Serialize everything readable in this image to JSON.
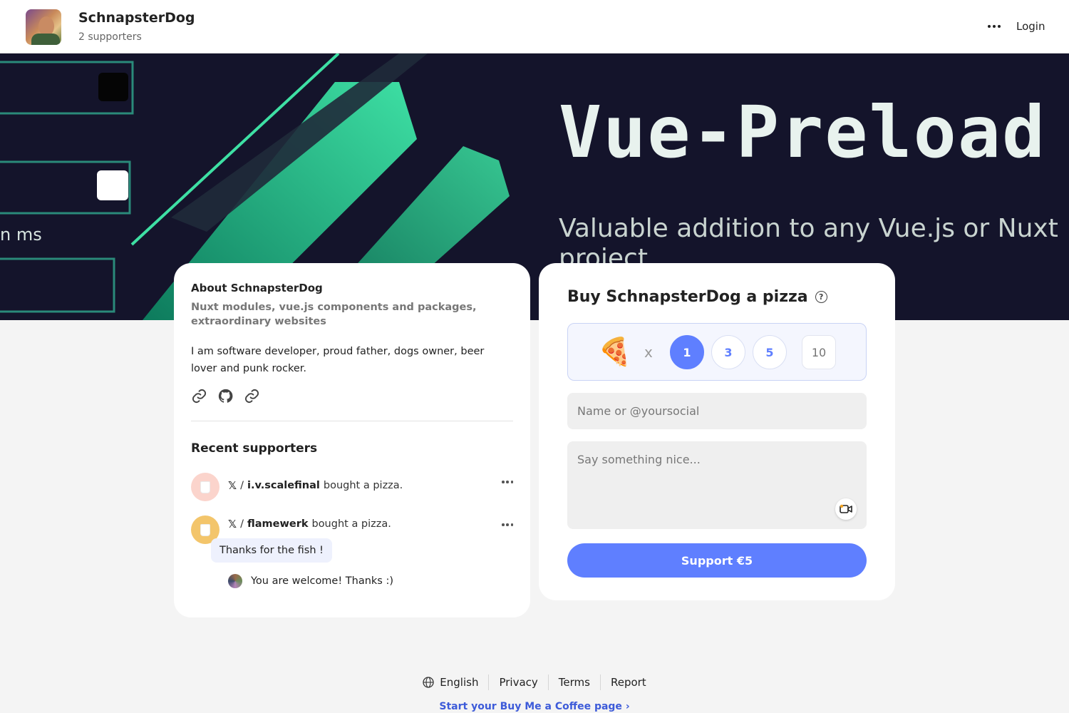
{
  "header": {
    "creator_name": "SchnapsterDog",
    "supporters": "2 supporters",
    "login": "Login",
    "more_icon": "more-horizontal-icon"
  },
  "banner": {
    "title": "Vue-Preload",
    "subtitle": "Valuable addition to any Vue.js or Nuxt",
    "subtitle_cut": "project",
    "left_text": "n ms"
  },
  "about": {
    "title": "About SchnapsterDog",
    "tagline": "Nuxt modules, vue.js components and packages, extraordinary websites",
    "bio": "I am software developer, proud father, dogs owner, beer lover and punk rocker.",
    "social_icons": [
      "link-icon",
      "github-icon",
      "link-icon"
    ]
  },
  "recent": {
    "title": "Recent supporters",
    "supporters": [
      {
        "platform": "𝕏",
        "separator": "/",
        "handle": "i.v.scalefinal",
        "action": "bought a pizza.",
        "avatar_color": "#fbd4cc"
      },
      {
        "platform": "𝕏",
        "separator": "/",
        "handle": "flamewerk",
        "action": "bought a pizza.",
        "avatar_color": "#f3c56b"
      }
    ],
    "message": "Thanks for the fish !",
    "reply": "You are welcome! Thanks :)"
  },
  "buy": {
    "title": "Buy SchnapsterDog a pizza",
    "help": "?",
    "pizza_emoji": "🍕",
    "times": "x",
    "quantities": [
      "1",
      "3",
      "5"
    ],
    "selected_quantity": "1",
    "custom_quantity_placeholder": "10",
    "name_placeholder": "Name or @yoursocial",
    "message_placeholder": "Say something nice...",
    "video_icon": "video-camera-icon",
    "support_label": "Support €5",
    "accent_color": "#5f7fff"
  },
  "footer": {
    "language": "English",
    "links": [
      "Privacy",
      "Terms",
      "Report"
    ],
    "start_link": "Start your Buy Me a Coffee page"
  }
}
